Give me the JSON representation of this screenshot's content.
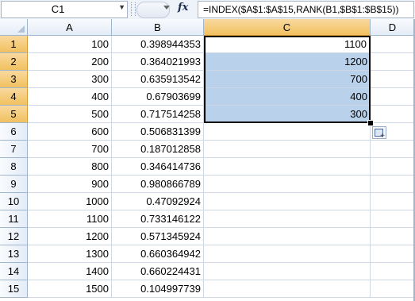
{
  "formula_bar": {
    "name_box": "C1",
    "fx_label": "fx",
    "formula": "=INDEX($A$1:$A$15,RANK(B1,$B$1:$B$15))"
  },
  "columns": [
    "A",
    "B",
    "C",
    "D"
  ],
  "rows": [
    {
      "num": "1",
      "a": "100",
      "b": "0.398944353",
      "c": "1100"
    },
    {
      "num": "2",
      "a": "200",
      "b": "0.364021993",
      "c": "1200"
    },
    {
      "num": "3",
      "a": "300",
      "b": "0.635913542",
      "c": "700"
    },
    {
      "num": "4",
      "a": "400",
      "b": "0.67903699",
      "c": "400"
    },
    {
      "num": "5",
      "a": "500",
      "b": "0.717514258",
      "c": "300"
    },
    {
      "num": "6",
      "a": "600",
      "b": "0.506831399",
      "c": ""
    },
    {
      "num": "7",
      "a": "700",
      "b": "0.187012858",
      "c": ""
    },
    {
      "num": "8",
      "a": "800",
      "b": "0.346414736",
      "c": ""
    },
    {
      "num": "9",
      "a": "900",
      "b": "0.980866789",
      "c": ""
    },
    {
      "num": "10",
      "a": "1000",
      "b": "0.47092924",
      "c": ""
    },
    {
      "num": "11",
      "a": "1100",
      "b": "0.733146122",
      "c": ""
    },
    {
      "num": "12",
      "a": "1200",
      "b": "0.571345924",
      "c": ""
    },
    {
      "num": "13",
      "a": "1300",
      "b": "0.660364942",
      "c": ""
    },
    {
      "num": "14",
      "a": "1400",
      "b": "0.660224431",
      "c": ""
    },
    {
      "num": "15",
      "a": "1500",
      "b": "0.104997739",
      "c": ""
    }
  ],
  "selection": {
    "column": "C",
    "rows": [
      1,
      5
    ],
    "active_cell": "C1"
  },
  "colors": {
    "selection_fill": "#b9d1ea",
    "header_selected": "#f1c15f",
    "gridline": "#d0d7e5",
    "header_border": "#9eb6ce"
  },
  "icons": {
    "name_box_dropdown": "chevron-down-icon",
    "paste_options": "paste-options-icon"
  }
}
